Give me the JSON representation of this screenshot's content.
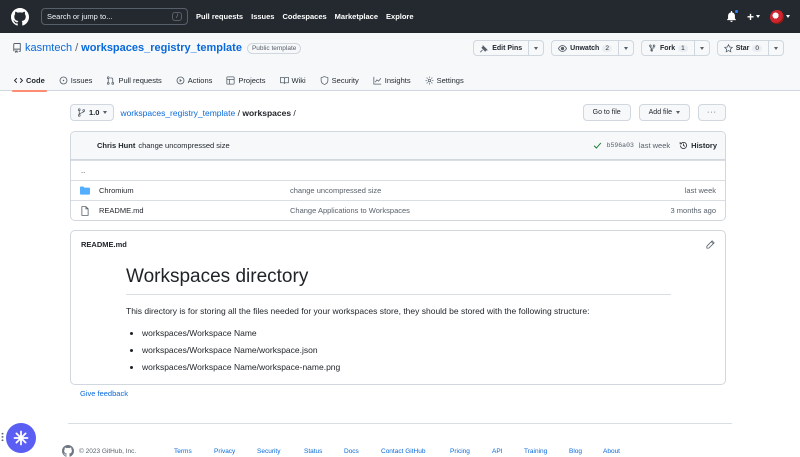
{
  "header": {
    "search_placeholder": "Search or jump to...",
    "search_shortcut": "/",
    "nav": [
      "Pull requests",
      "Issues",
      "Codespaces",
      "Marketplace",
      "Explore"
    ],
    "new_label": "+"
  },
  "repo": {
    "owner": "kasmtech",
    "separator": "/",
    "name": "workspaces_registry_template",
    "visibility": "Public template",
    "actions": {
      "edit_pins": "Edit Pins",
      "unwatch": "Unwatch",
      "unwatch_count": "2",
      "fork": "Fork",
      "fork_count": "1",
      "star": "Star",
      "star_count": "0"
    },
    "tabs": [
      {
        "label": "Code",
        "icon": "code-icon",
        "active": true
      },
      {
        "label": "Issues",
        "icon": "issue-icon"
      },
      {
        "label": "Pull requests",
        "icon": "pull-request-icon"
      },
      {
        "label": "Actions",
        "icon": "play-icon"
      },
      {
        "label": "Projects",
        "icon": "table-icon"
      },
      {
        "label": "Wiki",
        "icon": "book-icon"
      },
      {
        "label": "Security",
        "icon": "shield-icon"
      },
      {
        "label": "Insights",
        "icon": "graph-icon"
      },
      {
        "label": "Settings",
        "icon": "gear-icon"
      }
    ]
  },
  "path": {
    "branch": "1.0",
    "repo_link": "workspaces_registry_template",
    "sep1": "/",
    "folder": "workspaces",
    "sep2": "/",
    "go_to_file": "Go to file",
    "add_file": "Add file",
    "more": "···"
  },
  "commit": {
    "author": "Chris Hunt",
    "message": "change uncompressed size",
    "sha": "b596a03",
    "age": "last week",
    "history": "History"
  },
  "files": {
    "updir": "..",
    "rows": [
      {
        "name": "Chromium",
        "type": "dir",
        "message": "change uncompressed size",
        "age": "last week"
      },
      {
        "name": "README.md",
        "type": "file",
        "message": "Change Applications to Workspaces",
        "age": "3 months ago"
      }
    ]
  },
  "readme": {
    "filename": "README.md",
    "heading": "Workspaces directory",
    "paragraph": "This directory is for storing all the files needed for your workspaces store, they should be stored with the following structure:",
    "items": [
      "workspaces/Workspace Name",
      "workspaces/Workspace Name/workspace.json",
      "workspaces/Workspace Name/workspace-name.png"
    ]
  },
  "feedback": "Give feedback",
  "footer": {
    "copyright": "© 2023 GitHub, Inc.",
    "links": [
      "Terms",
      "Privacy",
      "Security",
      "Status",
      "Docs",
      "Contact GitHub",
      "Pricing",
      "API",
      "Training",
      "Blog",
      "About"
    ]
  },
  "colors": {
    "header_bg": "#24292f",
    "link": "#0969da",
    "active_tab_underline": "#fd8c73",
    "folder": "#54aeff",
    "fab": "#5b5ef2"
  }
}
